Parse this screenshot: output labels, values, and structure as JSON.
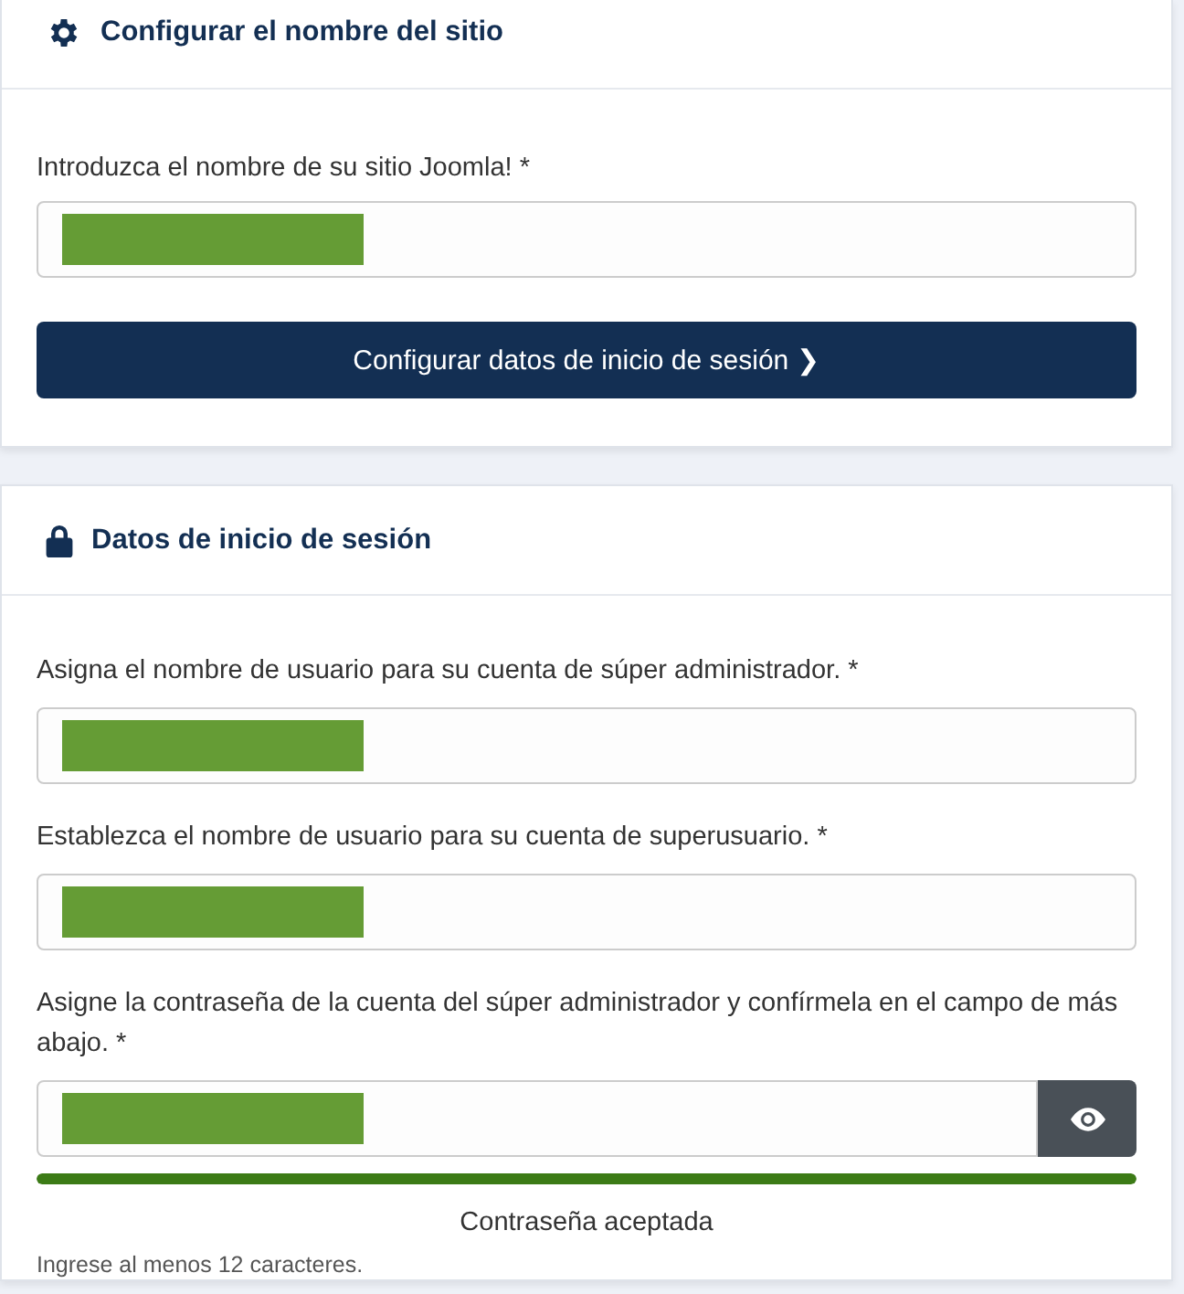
{
  "site_card": {
    "title": "Configurar el nombre del sitio",
    "field": {
      "label": "Introduzca el nombre de su sitio Joomla! *",
      "redacted": true
    },
    "button": {
      "label": "Configurar datos de inicio de sesión",
      "arrow": "❯"
    }
  },
  "login_card": {
    "title": "Datos de inicio de sesión",
    "fields": [
      {
        "label": "Asigna el nombre de usuario para su cuenta de súper administrador. *",
        "redacted": true
      },
      {
        "label": "Establezca el nombre de usuario para su cuenta de superusuario. *",
        "redacted": true
      }
    ],
    "password": {
      "label": "Asigne la contraseña de la cuenta del súper administrador y confírmela en el campo de más abajo. *",
      "redacted": true,
      "strength": {
        "level": 1,
        "message": "Contraseña aceptada"
      },
      "hint": "Ingrese al menos 12 caracteres."
    }
  }
}
